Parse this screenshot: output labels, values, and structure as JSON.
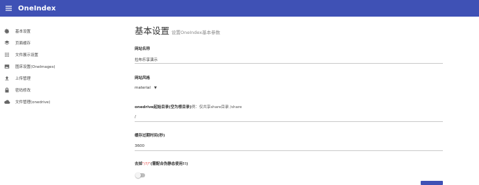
{
  "app": {
    "title": "OneIndex",
    "menu_icon": "menu-icon"
  },
  "sidebar": {
    "items": [
      {
        "label": "基本设置",
        "icon": "gear-icon"
      },
      {
        "label": "页面缓存",
        "icon": "layers-icon"
      },
      {
        "label": "文件展示设置",
        "icon": "grid-icon"
      },
      {
        "label": "图床设置(OneImages)",
        "icon": "image-icon"
      },
      {
        "label": "上传管理",
        "icon": "upload-icon"
      },
      {
        "label": "密码修改",
        "icon": "lock-icon"
      },
      {
        "label": "文件管理(onedrive)",
        "icon": "cloud-icon"
      }
    ]
  },
  "main": {
    "title": "基本设置",
    "subtitle": "设置OneIndex基本参数",
    "site_name": {
      "label": "网站名称",
      "value": "拉布乐享演示"
    },
    "site_style": {
      "label": "网站风格",
      "value": "material"
    },
    "root_dir": {
      "label": "onedrive起始目录(空为根目录)",
      "hint": "例：仅共享share目录 /share",
      "value": "/"
    },
    "cache_time": {
      "label": "缓存过期时间(秒)",
      "value": "3600"
    },
    "remove_slash": {
      "label_prefix": "去掉",
      "label_red": "\"/?/\"",
      "label_suffix": "(需配合伪静态使用!!)",
      "enabled": false
    }
  }
}
